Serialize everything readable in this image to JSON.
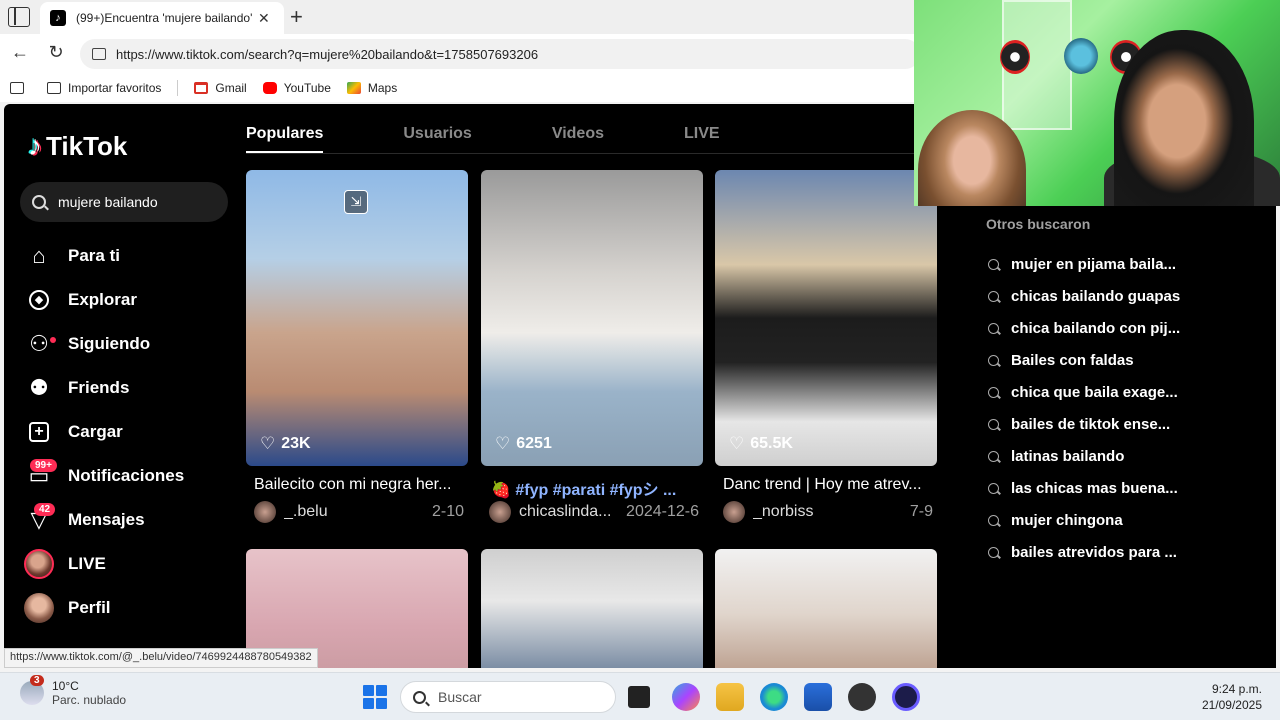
{
  "browser": {
    "tab_title": "(99+)Encuentra 'mujere bailando'",
    "url": "https://www.tiktok.com/search?q=mujere%20bailando&t=1758507693206",
    "bookmarks": [
      "Importar favoritos",
      "Gmail",
      "YouTube",
      "Maps"
    ],
    "status_url": "https://www.tiktok.com/@_.belu/video/7469924488780549382"
  },
  "tiktok": {
    "logo": "TikTok",
    "search_value": "mujere bailando",
    "menu": [
      {
        "label": "Para ti",
        "icon": "home-icon"
      },
      {
        "label": "Explorar",
        "icon": "compass-icon"
      },
      {
        "label": "Siguiendo",
        "icon": "following-icon"
      },
      {
        "label": "Friends",
        "icon": "friends-icon"
      },
      {
        "label": "Cargar",
        "icon": "upload-icon"
      },
      {
        "label": "Notificaciones",
        "icon": "inbox-icon",
        "badge": "99+"
      },
      {
        "label": "Mensajes",
        "icon": "messages-icon",
        "badge": "42"
      },
      {
        "label": "LIVE",
        "icon": "live-avatar"
      },
      {
        "label": "Perfil",
        "icon": "profile-avatar"
      }
    ],
    "tabs": [
      "Populares",
      "Usuarios",
      "Videos",
      "LIVE"
    ],
    "videos": [
      {
        "likes": "23K",
        "caption": "Bailecito con mi negra her...",
        "user": "_.belu",
        "date": "2-10"
      },
      {
        "likes": "6251",
        "caption": "#fyp #parati #fypシ ...",
        "prefix": "🍓",
        "user": "chicaslinda...",
        "date": "2024-12-6"
      },
      {
        "likes": "65.5K",
        "caption": "Danc trend | Hoy me atrev...",
        "user": "_norbiss",
        "date": "7-9"
      }
    ],
    "others_title": "Otros buscaron",
    "others": [
      "mujer en pijama baila...",
      "chicas bailando guapas",
      "chica bailando con pij...",
      "Bailes con faldas",
      "chica que baila exage...",
      "bailes de tiktok ense...",
      "latinas bailando",
      "las chicas mas buena...",
      "mujer chingona",
      "bailes atrevidos para ..."
    ]
  },
  "taskbar": {
    "weather_badge": "3",
    "temp": "10°C",
    "weather_desc": "Parc. nublado",
    "search_placeholder": "Buscar",
    "time": "9:24 p.m.",
    "date": "21/09/2025"
  }
}
